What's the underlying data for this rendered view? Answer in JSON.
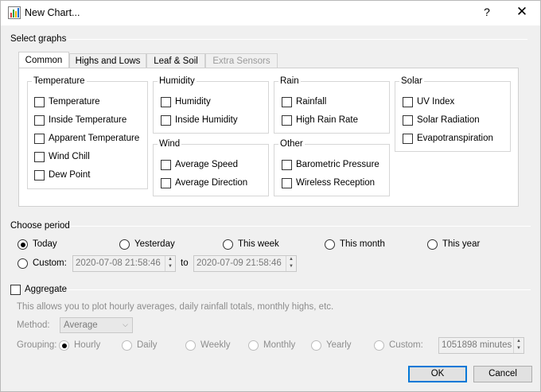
{
  "window": {
    "title": "New Chart...",
    "help_glyph": "?",
    "close_glyph": "✕",
    "icon": "chart-icon"
  },
  "select_graphs": {
    "label": "Select graphs",
    "tabs": [
      {
        "label": "Common",
        "active": true,
        "enabled": true
      },
      {
        "label": "Highs and Lows",
        "active": false,
        "enabled": true
      },
      {
        "label": "Leaf & Soil",
        "active": false,
        "enabled": true
      },
      {
        "label": "Extra Sensors",
        "active": false,
        "enabled": false
      }
    ],
    "groups": {
      "temperature": {
        "title": "Temperature",
        "items": [
          "Temperature",
          "Inside Temperature",
          "Apparent Temperature",
          "Wind Chill",
          "Dew Point"
        ]
      },
      "humidity": {
        "title": "Humidity",
        "items": [
          "Humidity",
          "Inside Humidity"
        ]
      },
      "wind": {
        "title": "Wind",
        "items": [
          "Average Speed",
          "Average Direction"
        ]
      },
      "rain": {
        "title": "Rain",
        "items": [
          "Rainfall",
          "High Rain Rate"
        ]
      },
      "other": {
        "title": "Other",
        "items": [
          "Barometric Pressure",
          "Wireless Reception"
        ]
      },
      "solar": {
        "title": "Solar",
        "items": [
          "UV Index",
          "Solar Radiation",
          "Evapotranspiration"
        ]
      }
    }
  },
  "choose_period": {
    "label": "Choose period",
    "options": [
      {
        "label": "Today",
        "checked": true
      },
      {
        "label": "Yesterday",
        "checked": false
      },
      {
        "label": "This week",
        "checked": false
      },
      {
        "label": "This month",
        "checked": false
      },
      {
        "label": "This year",
        "checked": false
      }
    ],
    "custom": {
      "label": "Custom:",
      "checked": false,
      "from": "2020-07-08 21:58:46",
      "to_label": "to",
      "to": "2020-07-09 21:58:46"
    }
  },
  "aggregate": {
    "label": "Aggregate",
    "checked": false,
    "description": "This allows you to plot hourly averages, daily rainfall totals, monthly highs, etc.",
    "method": {
      "label": "Method:",
      "value": "Average"
    },
    "grouping": {
      "label": "Grouping:",
      "options": [
        {
          "label": "Hourly",
          "checked": true
        },
        {
          "label": "Daily",
          "checked": false
        },
        {
          "label": "Weekly",
          "checked": false
        },
        {
          "label": "Monthly",
          "checked": false
        },
        {
          "label": "Yearly",
          "checked": false
        },
        {
          "label": "Custom:",
          "checked": false
        }
      ],
      "custom_value": "1051898 minutes"
    }
  },
  "buttons": {
    "ok": "OK",
    "cancel": "Cancel"
  }
}
